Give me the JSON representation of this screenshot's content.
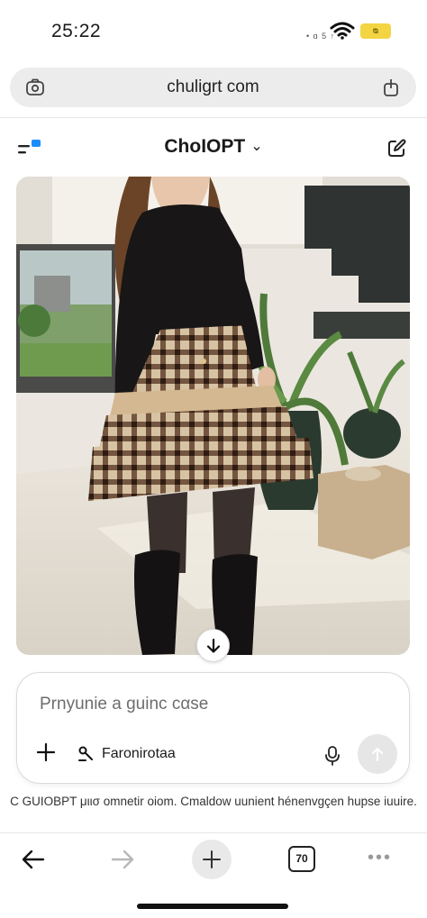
{
  "status_bar": {
    "time": "25:22",
    "signal_text": "• ɑ 5 ↑",
    "battery_label": "ᴓ"
  },
  "browser": {
    "url": "chuligrt com",
    "left_icon": "tab-camera-icon",
    "right_icon": "share-icon"
  },
  "app_header": {
    "title": "ChoIOPT",
    "chevron": "⌄",
    "menu_icon": "menu-icon",
    "edit_icon": "new-chat-icon"
  },
  "image": {
    "description_icon": "generated-image",
    "scroll_icon": "arrow-down-icon"
  },
  "composer": {
    "placeholder": "Prnyunie a guinc cαse",
    "tools_label": "Faronirotaa",
    "plus_icon": "plus-icon",
    "tools_icon": "tools-icon",
    "mic_icon": "mic-icon",
    "send_icon": "arrow-up-icon"
  },
  "disclaimer": "C GUIOBPT μιισ omnetir oiom. Cmaldow uunient hénenvgçen hupse iuuire.",
  "bottom_nav": {
    "tabs_count": "70",
    "more_label": "•••"
  },
  "colors": {
    "accent_blue": "#1a8cff",
    "battery_yellow": "#f3d443",
    "composer_border": "#dadada"
  }
}
